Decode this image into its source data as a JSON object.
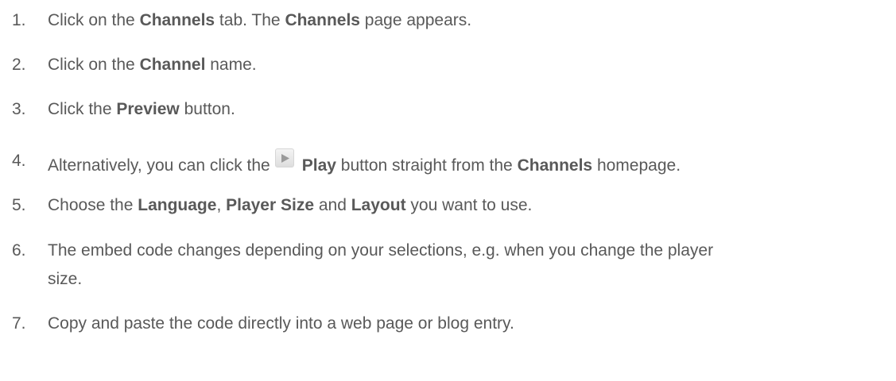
{
  "steps": [
    {
      "num": "1.",
      "parts": [
        "Click on the ",
        "Channels",
        " tab. The ",
        "Channels",
        " page appears."
      ]
    },
    {
      "num": "2.",
      "parts": [
        "Click on the ",
        "Channel",
        " name."
      ]
    },
    {
      "num": "3.",
      "parts": [
        "Click the ",
        "Preview",
        " button."
      ]
    },
    {
      "num": "4.",
      "before": "Alternatively, you can click the",
      "icon": "play-icon",
      "parts": [
        "Play",
        " button straight from the ",
        "Channels",
        " homepage."
      ]
    },
    {
      "num": "5.",
      "parts": [
        "Choose the ",
        "Language",
        ", ",
        "Player Size",
        " and ",
        "Layout",
        " you want to use."
      ]
    },
    {
      "num": "6.",
      "lines": [
        "The embed code changes depending on your selections, e.g. when you change the player",
        "size."
      ]
    },
    {
      "num": "7.",
      "parts": [
        "Copy and paste the code directly into a web page or blog entry."
      ]
    }
  ]
}
